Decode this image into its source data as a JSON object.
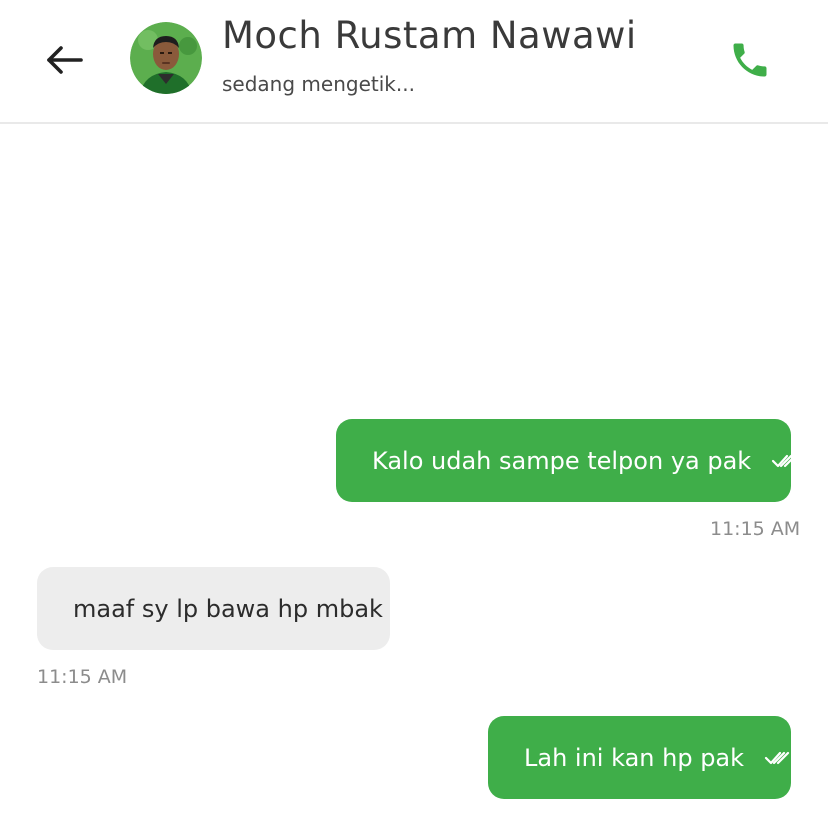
{
  "header": {
    "contact_name": "Moch Rustam Nawawi",
    "status": "sedang mengetik...",
    "back_icon": "arrow-left-icon",
    "call_icon": "phone-icon"
  },
  "messages": [
    {
      "direction": "outgoing",
      "text": "Kalo udah sampe telpon ya pak",
      "time": "11:15 AM",
      "status_icon": "double-check-icon"
    },
    {
      "direction": "incoming",
      "text": "maaf sy lp bawa hp mbak",
      "time": "11:15 AM"
    },
    {
      "direction": "outgoing",
      "text": "Lah ini kan hp pak",
      "status_icon": "double-check-icon"
    }
  ],
  "colors": {
    "accent_green": "#3fae49",
    "incoming_bubble": "#ededed",
    "timestamp": "#8c8c8c"
  }
}
